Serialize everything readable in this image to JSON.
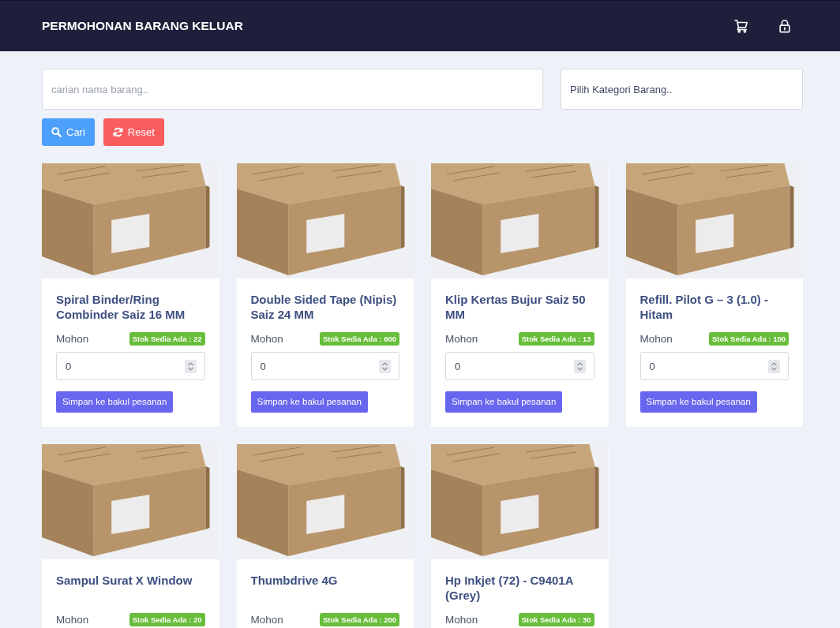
{
  "header": {
    "title": "PERMOHONAN BARANG KELUAR"
  },
  "search": {
    "placeholder": "carian nama barang.."
  },
  "category_select": {
    "value": "Pilih Kategori Barang.."
  },
  "buttons": [
    {
      "kind": "search",
      "label": "Cari"
    },
    {
      "kind": "reset",
      "label": "Reset"
    }
  ],
  "products": [
    {
      "name": "Spiral Binder/Ring Combinder Saiz 16 MM",
      "request_label": "Mohon",
      "stock": "Stok Sedia Ada : 22",
      "quantity": "0",
      "button": "Simpan ke bakul pesanan"
    },
    {
      "name": "Double Sided Tape (Nipis) Saiz 24 MM",
      "request_label": "Mohon",
      "stock": "Stok Sedia Ada : 600",
      "quantity": "0",
      "button": "Simpan ke bakul pesanan"
    },
    {
      "name": "Klip Kertas Bujur Saiz 50 MM",
      "request_label": "Mohon",
      "stock": "Stok Sedia Ada : 13",
      "quantity": "0",
      "button": "Simpan ke bakul pesanan"
    },
    {
      "name": "Refill. Pilot G – 3 (1.0) - Hitam",
      "request_label": "Mohon",
      "stock": "Stok Sedia Ada : 100",
      "quantity": "0",
      "button": "Simpan ke bakul pesanan"
    },
    {
      "name": "Sampul Surat X Window",
      "request_label": "Mohon",
      "stock": "Stok Sedia Ada : 20"
    },
    {
      "name": "Thumbdrive 4G",
      "request_label": "Mohon",
      "stock": "Stok Sedia Ada : 200"
    },
    {
      "name": "Hp Inkjet (72) - C9401A (Grey)",
      "request_label": "Mohon",
      "stock": "Stok Sedia Ada : 30"
    }
  ]
}
